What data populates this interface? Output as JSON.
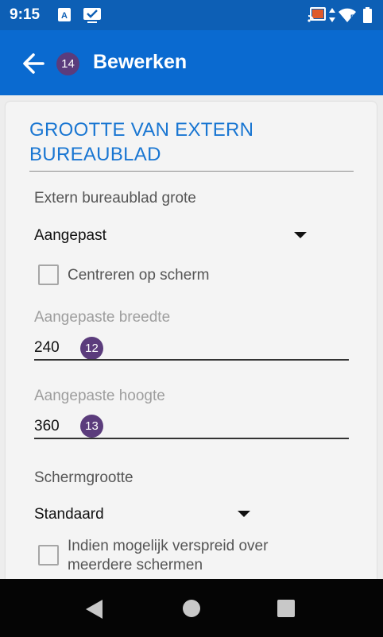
{
  "status": {
    "time": "9:15",
    "network_label": "5"
  },
  "appbar": {
    "title": "Bewerken",
    "badge": "14"
  },
  "section": {
    "title": "GROOTTE VAN EXTERN BUREAUBLAD"
  },
  "remote_size": {
    "label": "Extern bureaublad grote",
    "value": "Aangepast"
  },
  "center": {
    "label": "Centreren op scherm",
    "checked": false
  },
  "width_field": {
    "label": "Aangepaste breedte",
    "value": "240",
    "badge": "12"
  },
  "height_field": {
    "label": "Aangepaste hoogte",
    "value": "360",
    "badge": "13"
  },
  "screen_size": {
    "label": "Schermgrootte",
    "value": "Standaard"
  },
  "spread": {
    "label": "Indien mogelijk verspreid over meerdere schermen",
    "checked": false
  },
  "colors": {
    "statusbar": "#0d5fb5",
    "appbar": "#0a6ad0",
    "accent": "#1976d2",
    "badge": "#5b3c7c"
  }
}
